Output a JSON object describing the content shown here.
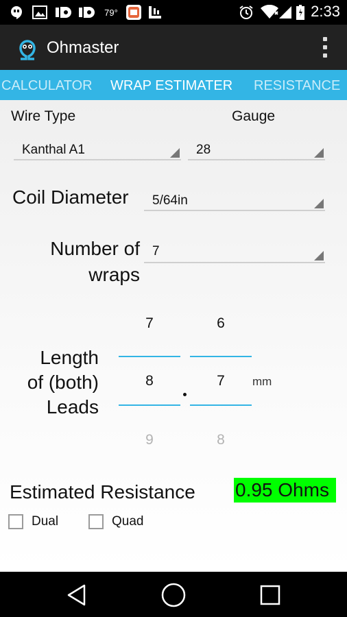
{
  "status_bar": {
    "temperature": "79°",
    "time": "2:33",
    "icons": [
      "hangouts-icon",
      "image-icon",
      "beats-icon",
      "beats-icon",
      "app-notification-icon",
      "letterboxd-icon",
      "alarm-icon",
      "wifi-icon",
      "signal-icon",
      "battery-icon"
    ]
  },
  "app_bar": {
    "title": "Ohmaster",
    "logo_icon": "omega-icon",
    "menu_icon": "overflow-menu-icon"
  },
  "tabs": {
    "items": [
      {
        "label": "CALCULATOR",
        "selected": false
      },
      {
        "label": "WRAP ESTIMATER",
        "selected": true
      },
      {
        "label": "RESISTANCE",
        "selected": false
      }
    ],
    "color": "#33b5e5"
  },
  "form": {
    "wire_type_label": "Wire Type",
    "wire_type_value": "Kanthal A1",
    "gauge_label": "Gauge",
    "gauge_value": "28",
    "coil_diameter_label": "Coil Diameter",
    "coil_diameter_value": "5/64in",
    "wraps_label_line1": "Number of",
    "wraps_label_line2": "wraps",
    "wraps_value": "7",
    "leads_label_line1": "Length",
    "leads_label_line2": "of (both)",
    "leads_label_line3": "Leads",
    "leads_unit": "mm",
    "picker_left": {
      "prev": "7",
      "current": "8",
      "next": "9"
    },
    "picker_right": {
      "prev": "6",
      "current": "7",
      "next": "8"
    }
  },
  "result": {
    "label": "Estimated Resistance",
    "value": "0.95 Ohms",
    "highlight_color": "#00ff00"
  },
  "options": {
    "dual_label": "Dual",
    "dual_checked": false,
    "quad_label": "Quad",
    "quad_checked": false
  },
  "nav_bar": {
    "icons": [
      "back-icon",
      "home-icon",
      "recents-icon"
    ]
  }
}
